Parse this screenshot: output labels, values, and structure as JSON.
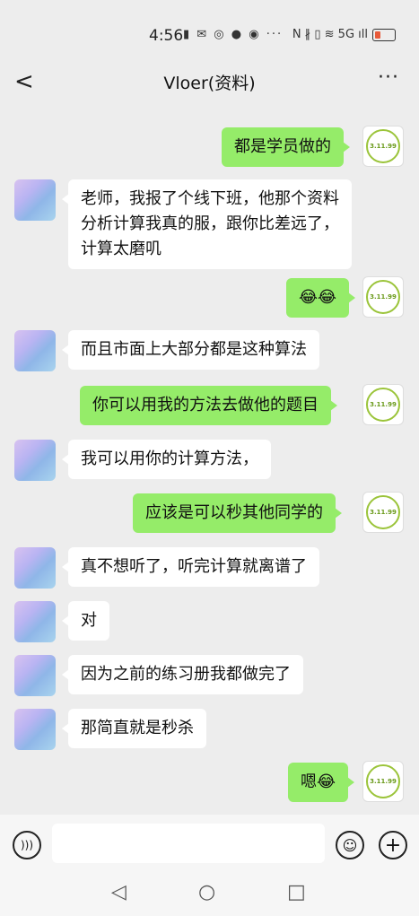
{
  "status_bar": {
    "time": "4:56",
    "left_icons": "▮ ✉ ◎ ● ◉ ···",
    "right_icons": "N ∦ ▯ ≋ 5G ıll"
  },
  "header": {
    "title": "Vloer(资料)",
    "back_label": "<",
    "more_label": "···"
  },
  "self_avatar_label": "3.11.99",
  "messages": [
    {
      "side": "me",
      "text": "都是学员做的"
    },
    {
      "side": "other",
      "text": "老师，我报了个线下班，他那个资料分析计算我真的服，跟你比差远了，计算太磨叽"
    },
    {
      "side": "me",
      "text": "😂😂"
    },
    {
      "side": "other",
      "text": "而且市面上大部分都是这种算法"
    },
    {
      "side": "me",
      "text": "你可以用我的方法去做他的题目"
    },
    {
      "side": "other",
      "text": "我可以用你的计算方法，"
    },
    {
      "side": "me",
      "text": "应该是可以秒其他同学的"
    },
    {
      "side": "other",
      "text": "真不想听了，听完计算就离谱了"
    },
    {
      "side": "other",
      "text": "对"
    },
    {
      "side": "other",
      "text": "因为之前的练习册我都做完了"
    },
    {
      "side": "other",
      "text": "那简直就是秒杀"
    },
    {
      "side": "me",
      "text": "嗯😂"
    }
  ],
  "input_bar": {
    "voice_icon": "voice-icon",
    "emoji_icon": "emoji-icon",
    "plus_icon": "plus-icon"
  },
  "system_nav": {
    "back": "◁",
    "home": "○",
    "recent": "□"
  },
  "colors": {
    "me_bubble": "#95ec69",
    "other_bubble": "#ffffff",
    "background": "#ededed"
  }
}
